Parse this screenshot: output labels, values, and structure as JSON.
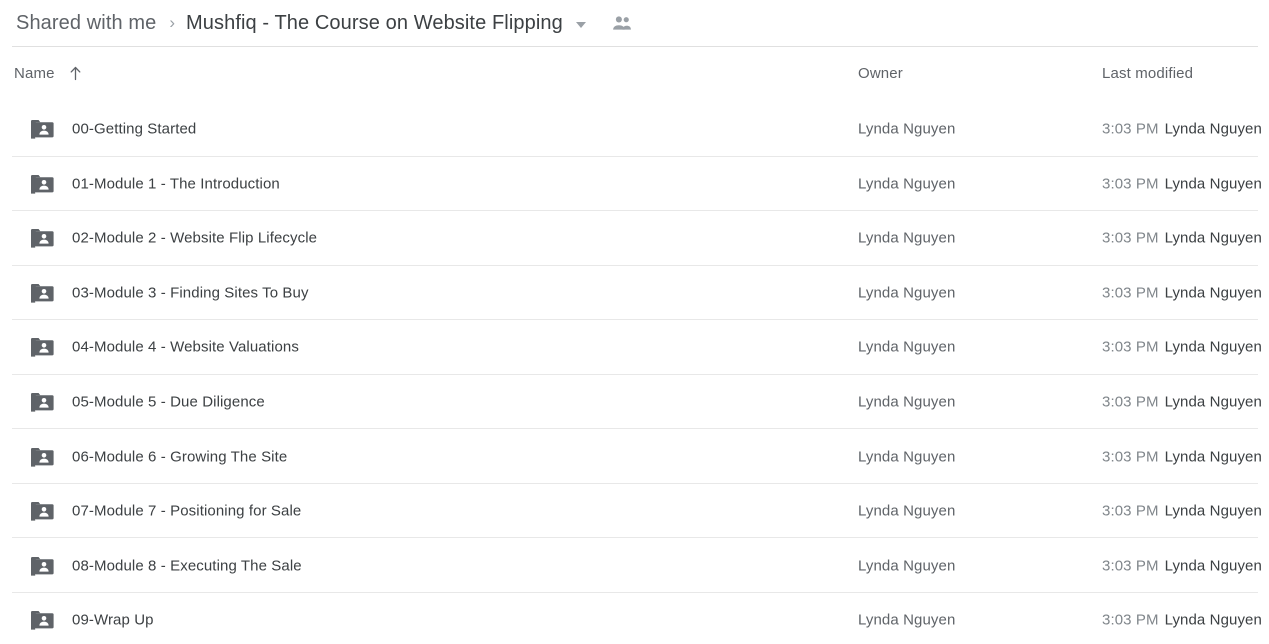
{
  "breadcrumb": {
    "parent_label": "Shared with me",
    "separator": "›",
    "current_label": "Mushfiq - The Course on Website Flipping",
    "dropdown_icon": "chevron-down-icon",
    "share_icon": "people-icon"
  },
  "columns": {
    "name": "Name",
    "name_sort": "ascending",
    "sort_icon": "arrow-up-icon",
    "owner": "Owner",
    "last_modified": "Last modified"
  },
  "colors": {
    "text_primary": "#3c4043",
    "text_secondary": "#5f6368",
    "text_muted": "#80868b",
    "divider": "#e0e0e0",
    "row_divider": "#e8e8e8",
    "folder_icon": "#5f6368",
    "background": "#ffffff"
  },
  "rows": [
    {
      "icon": "shared-folder-icon",
      "name": "00-Getting Started",
      "owner": "Lynda Nguyen",
      "modified_time": "3:03 PM",
      "modified_by": "Lynda Nguyen"
    },
    {
      "icon": "shared-folder-icon",
      "name": "01-Module 1 - The Introduction",
      "owner": "Lynda Nguyen",
      "modified_time": "3:03 PM",
      "modified_by": "Lynda Nguyen"
    },
    {
      "icon": "shared-folder-icon",
      "name": "02-Module 2 - Website Flip Lifecycle",
      "owner": "Lynda Nguyen",
      "modified_time": "3:03 PM",
      "modified_by": "Lynda Nguyen"
    },
    {
      "icon": "shared-folder-icon",
      "name": "03-Module 3 - Finding Sites To Buy",
      "owner": "Lynda Nguyen",
      "modified_time": "3:03 PM",
      "modified_by": "Lynda Nguyen"
    },
    {
      "icon": "shared-folder-icon",
      "name": "04-Module 4 - Website Valuations",
      "owner": "Lynda Nguyen",
      "modified_time": "3:03 PM",
      "modified_by": "Lynda Nguyen"
    },
    {
      "icon": "shared-folder-icon",
      "name": "05-Module 5 - Due Diligence",
      "owner": "Lynda Nguyen",
      "modified_time": "3:03 PM",
      "modified_by": "Lynda Nguyen"
    },
    {
      "icon": "shared-folder-icon",
      "name": "06-Module 6 - Growing The Site",
      "owner": "Lynda Nguyen",
      "modified_time": "3:03 PM",
      "modified_by": "Lynda Nguyen"
    },
    {
      "icon": "shared-folder-icon",
      "name": "07-Module 7 - Positioning for Sale",
      "owner": "Lynda Nguyen",
      "modified_time": "3:03 PM",
      "modified_by": "Lynda Nguyen"
    },
    {
      "icon": "shared-folder-icon",
      "name": "08-Module 8 - Executing The Sale",
      "owner": "Lynda Nguyen",
      "modified_time": "3:03 PM",
      "modified_by": "Lynda Nguyen"
    },
    {
      "icon": "shared-folder-icon",
      "name": "09-Wrap Up",
      "owner": "Lynda Nguyen",
      "modified_time": "3:03 PM",
      "modified_by": "Lynda Nguyen"
    }
  ]
}
